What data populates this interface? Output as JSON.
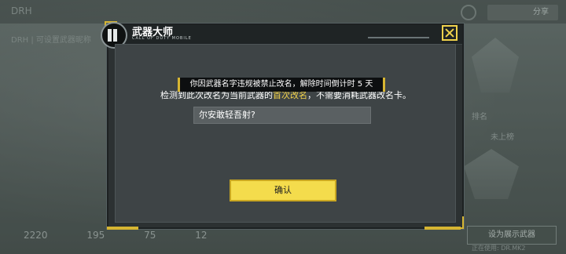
{
  "background": {
    "logo": "DRH",
    "code_text": "DRH | 可设置武器昵称",
    "share_label": "分享",
    "rank_label": "排名",
    "unlisted_label": "未上榜",
    "stats": [
      "2220",
      "195",
      "75",
      "12"
    ],
    "action_button": "设为展示武器",
    "sub_text": "正在使用: DR.MK2"
  },
  "dialog": {
    "title": "武器大师",
    "tagline": "CALL OF DUTY MOBILE",
    "message_prefix": "检测到此次改名为当前武器的",
    "message_highlight": "首次改名",
    "message_suffix": "，不需要消耗武器改名卡。",
    "input_value": "尔安敢轻吾射?",
    "confirm_label": "确认"
  },
  "toast": {
    "text": "你因武器名字违规被禁止改名，解除时间倒计时 5 天"
  },
  "colors": {
    "accent": "#f4dc4c",
    "highlight": "#f4d44a",
    "panel": "#3e4446",
    "header": "#1f2425"
  }
}
